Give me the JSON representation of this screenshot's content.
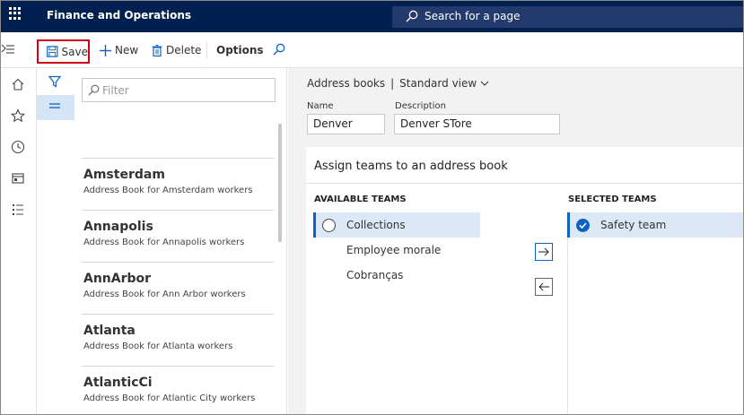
{
  "app": {
    "title": "Finance and Operations",
    "search_placeholder": "Search for a page"
  },
  "actionbar": {
    "save_label": "Save",
    "new_label": "New",
    "delete_label": "Delete",
    "options_label": "Options"
  },
  "leftnav": {
    "icons": [
      "home-icon",
      "star-icon",
      "clock-icon",
      "workspace-icon",
      "modules-icon"
    ]
  },
  "listpane": {
    "filter_placeholder": "Filter",
    "items": [
      {
        "title": "Amsterdam",
        "subtitle": "Address Book for Amsterdam workers"
      },
      {
        "title": "Annapolis",
        "subtitle": "Address Book for Annapolis workers"
      },
      {
        "title": "AnnArbor",
        "subtitle": "Address Book for Ann Arbor workers"
      },
      {
        "title": "Atlanta",
        "subtitle": "Address Book for Atlanta workers"
      },
      {
        "title": "AtlanticCi",
        "subtitle": "Address Book for Atlantic City workers"
      }
    ]
  },
  "main": {
    "breadcrumb": "Address books",
    "separator": "|",
    "view": "Standard view",
    "name_label": "Name",
    "name_value": "Denver",
    "description_label": "Description",
    "description_value": "Denver STore",
    "card_title": "Assign teams to an address book",
    "available_header": "AVAILABLE TEAMS",
    "selected_header": "SELECTED TEAMS",
    "available_teams": [
      "Collections",
      "Employee morale",
      "Cobranças"
    ],
    "selected_teams": [
      "Safety team"
    ]
  },
  "colors": {
    "topbar": "#002050",
    "accent": "#0f62c5",
    "highlight_border": "#d0021b"
  }
}
